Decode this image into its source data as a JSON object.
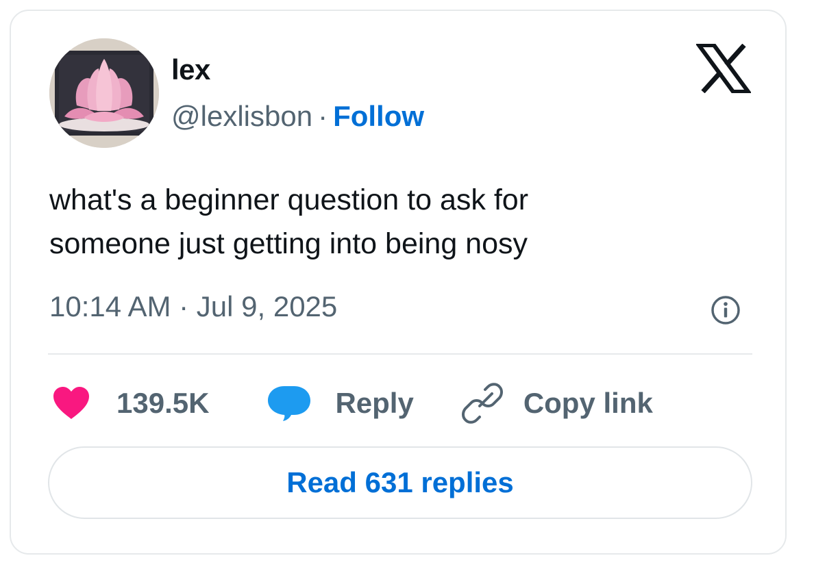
{
  "author": {
    "name": "lex",
    "handle": "@lexlisbon",
    "separator": "·",
    "follow_label": "Follow",
    "avatar_icon": "lotus-avatar"
  },
  "platform_icon": "x-logo-icon",
  "tweet": {
    "line1": "what's a beginner question to ask for",
    "line2": "someone just getting into being nosy"
  },
  "timestamp": "10:14 AM · Jul 9, 2025",
  "actions": {
    "like_count": "139.5K",
    "reply_label": "Reply",
    "copy_link_label": "Copy link"
  },
  "read_replies_label": "Read 631 replies",
  "colors": {
    "heart": "#f91880",
    "reply_bubble": "#1d9bf0",
    "link_blue": "#006fd6",
    "secondary_text": "#536471",
    "primary_text": "#0f1419"
  }
}
